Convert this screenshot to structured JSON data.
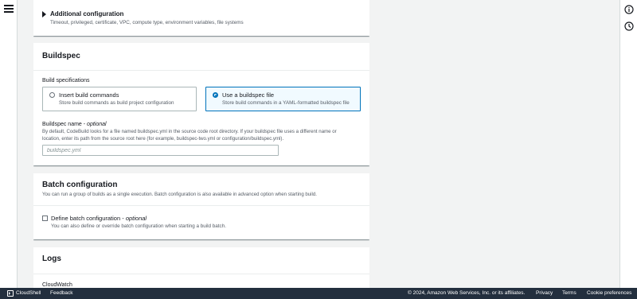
{
  "additional": {
    "title": "Additional configuration",
    "description": "Timeout, privileged, certificate, VPC, compute type, environment variables, file systems"
  },
  "buildspec": {
    "title": "Buildspec",
    "spec_label": "Build specifications",
    "options": [
      {
        "title": "Insert build commands",
        "description": "Store build commands as build project configuration",
        "selected": false
      },
      {
        "title": "Use a buildspec file",
        "description": "Store build commands in a YAML-formatted buildspec file",
        "selected": true
      }
    ],
    "name_label": "Buildspec name",
    "name_optional": "optional",
    "help_line1": "By default, CodeBuild looks for a file named buildspec.yml in the source code root directory. If your buildspec file uses a different name or",
    "help_line2": "location, enter its path from the source root here (for example, buildspec-two.yml or configuration/buildspec.yml).",
    "name_value": "",
    "name_placeholder": "buildspec.yml"
  },
  "batch": {
    "title": "Batch configuration",
    "description": "You can run a group of builds as a single execution. Batch configuration is also available in advanced option when starting build.",
    "checkbox_label": "Define batch configuration",
    "checkbox_optional": "optional",
    "checkbox_description": "You can also define or override batch configuration when starting a build batch.",
    "checked": false
  },
  "logs": {
    "title": "Logs",
    "cloudwatch_label": "CloudWatch"
  },
  "footer": {
    "cloudshell": "CloudShell",
    "feedback": "Feedback",
    "copyright": "© 2024, Amazon Web Services, Inc. or its affiliates.",
    "privacy": "Privacy",
    "terms": "Terms",
    "cookie": "Cookie preferences"
  },
  "icons": {
    "menu": "hamburger-menu-icon",
    "info": "info-icon",
    "history": "history-icon",
    "cloudshell": "cloudshell-icon"
  },
  "colors": {
    "accent": "#0073bb",
    "footer_bg": "#232f3e",
    "page_bg": "#f2f3f3"
  }
}
